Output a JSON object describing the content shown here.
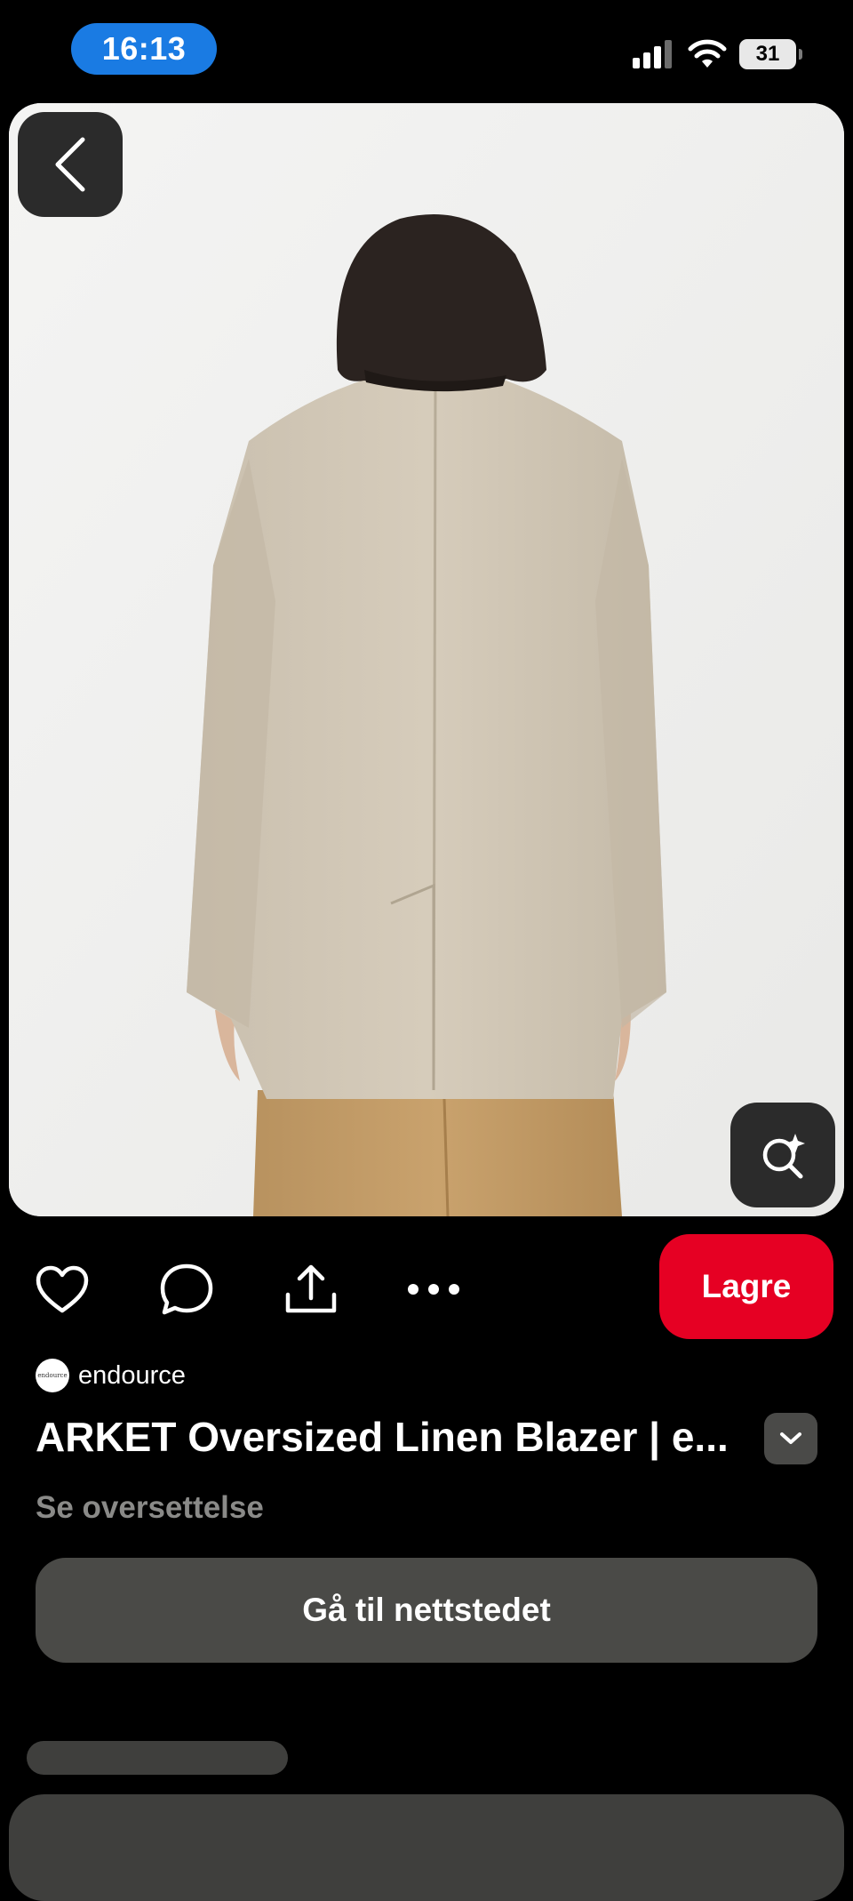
{
  "status_bar": {
    "time": "16:13",
    "battery": "31",
    "icons": [
      "signal-icon",
      "wifi-icon",
      "battery-icon"
    ]
  },
  "hero": {
    "icons": {
      "back": "chevron-left-icon",
      "visual_search": "visual-search-icon"
    }
  },
  "actions": {
    "icons": [
      "heart-icon",
      "comment-icon",
      "share-icon",
      "more-icon"
    ],
    "save_label": "Lagre"
  },
  "pin": {
    "creator_name": "endource",
    "creator_avatar_text": "endource",
    "title": "ARKET Oversized Linen Blazer | e...",
    "translate_label": "Se oversettelse",
    "visit_label": "Gå til nettstedet"
  },
  "colors": {
    "save_button": "#e60023",
    "time_pill": "#1a7be3",
    "secondary_button": "#4a4a47",
    "background": "#000000"
  }
}
